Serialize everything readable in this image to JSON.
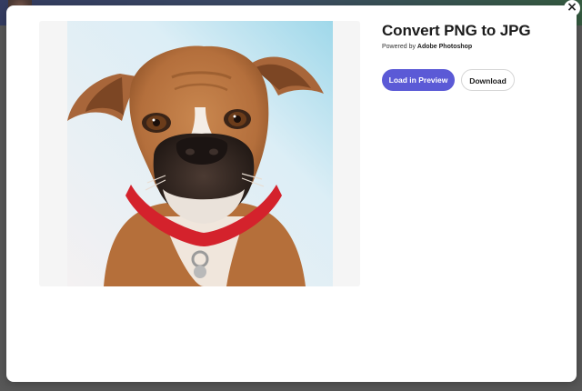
{
  "modal": {
    "title": "Convert PNG to JPG",
    "powered_prefix": "Powered by ",
    "powered_brand": "Adobe Photoshop",
    "close_label": "×"
  },
  "actions": {
    "load_preview_label": "Load in Preview",
    "download_label": "Download"
  },
  "preview": {
    "subject": "boxer dog photo"
  },
  "colors": {
    "accent": "#5b5ad6",
    "collar": "#d4222c",
    "overlay": "#737373"
  }
}
